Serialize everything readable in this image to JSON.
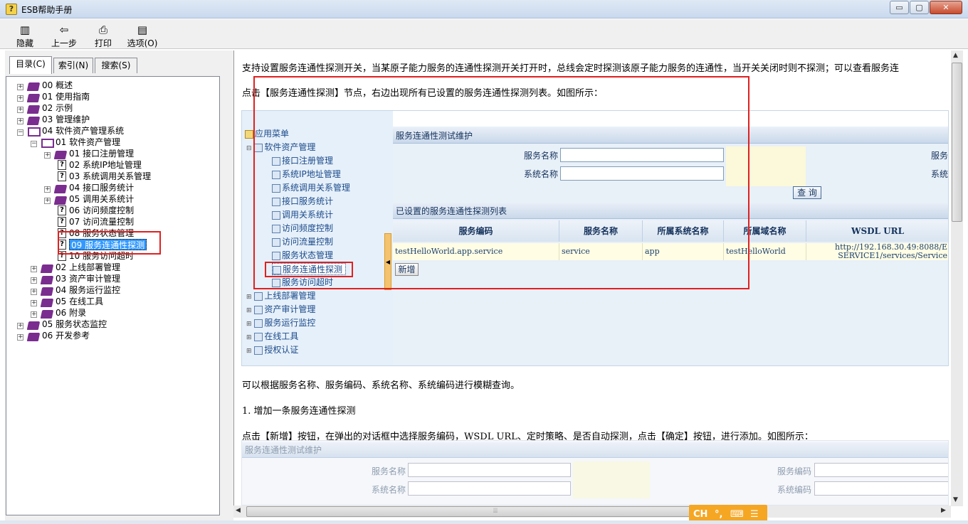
{
  "window": {
    "title": "ESB帮助手册",
    "icon": "help-book-icon",
    "controls": {
      "minimize": "▭",
      "restore": "▢",
      "close": "✕"
    }
  },
  "toolbar": {
    "hide": "隐藏",
    "back": "上一步",
    "print": "打印",
    "options": "选项(O)"
  },
  "tabs": {
    "contents": "目录(C)",
    "index": "索引(N)",
    "search": "搜索(S)"
  },
  "tree": [
    {
      "label": "00 概述"
    },
    {
      "label": "01 使用指南"
    },
    {
      "label": "02 示例"
    },
    {
      "label": "03 管理维护"
    },
    {
      "label": "04 软件资产管理系统"
    },
    {
      "label": "01 软件资产管理"
    },
    {
      "label": "01 接口注册管理"
    },
    {
      "label": "02 系统IP地址管理"
    },
    {
      "label": "03 系统调用关系管理"
    },
    {
      "label": "04 接口服务统计"
    },
    {
      "label": "05 调用关系统计"
    },
    {
      "label": "06 访问频度控制"
    },
    {
      "label": "07 访问流量控制"
    },
    {
      "label": "08 服务状态管理"
    },
    {
      "label": "09 服务连通性探测"
    },
    {
      "label": "10 服务访问超时"
    },
    {
      "label": "02 上线部署管理"
    },
    {
      "label": "03 资产审计管理"
    },
    {
      "label": "04 服务运行监控"
    },
    {
      "label": "05 在线工具"
    },
    {
      "label": "06 附录"
    },
    {
      "label": "05 服务状态监控"
    },
    {
      "label": "06 开发参考"
    }
  ],
  "content": {
    "p1": "支持设置服务连通性探测开关，当某原子能力服务的连通性探测开关打开时，总线会定时探测该原子能力服务的连通性，当开关关闭时则不探测；可以查看服务连",
    "p2": "点击【服务连通性探测】节点，右边出现所有已设置的服务连通性探测列表。如图所示：",
    "p3": "可以根据服务名称、服务编码、系统名称、系统编码进行模糊查询。",
    "p4": "1. 增加一条服务连通性探测",
    "p5": "点击【新增】按钮，在弹出的对话框中选择服务编码，WSDL URL、定时策略、是否自动探测，点击【确定】按钮，进行添加。如图所示："
  },
  "shot1": {
    "menu_root": "应用菜单",
    "menu_group": "软件资产管理",
    "menu_items": [
      "接口注册管理",
      "系统IP地址管理",
      "系统调用关系管理",
      "接口服务统计",
      "调用关系统计",
      "访问频度控制",
      "访问流量控制",
      "服务状态管理",
      "服务连通性探测",
      "服务访问超时"
    ],
    "menu_groups2": [
      "上线部署管理",
      "资产审计管理",
      "服务运行监控",
      "在线工具",
      "授权认证"
    ],
    "panel_title": "服务连通性测试维护",
    "label_service_name": "服务名称",
    "label_system_name": "系统名称",
    "label_service_code_cut": "服务",
    "label_system_code_cut": "系统",
    "query_btn": "查 询",
    "list_title": "已设置的服务连通性探测列表",
    "columns": [
      "服务编码",
      "服务名称",
      "所属系统名称",
      "所属域名称",
      "WSDL URL"
    ],
    "row": [
      "testHelloWorld.app.service",
      "service",
      "app",
      "testHelloWorld",
      "http://192.168.30.49:8088/E",
      "SERVICE1/services/Service"
    ],
    "add_btn": "新增"
  },
  "shot2": {
    "title": "服务连通性测试维护",
    "label_service_name": "服务名称",
    "label_service_code": "服务编码",
    "label_system_name": "系统名称",
    "label_system_code": "系统编码"
  },
  "ime": {
    "lang": "CH",
    "punct": "°,",
    "keyboard": "⌨",
    "menu": "☰"
  },
  "colors": {
    "highlight": "#e02020",
    "ime": "#f5a623",
    "selected": "#3399ff"
  }
}
